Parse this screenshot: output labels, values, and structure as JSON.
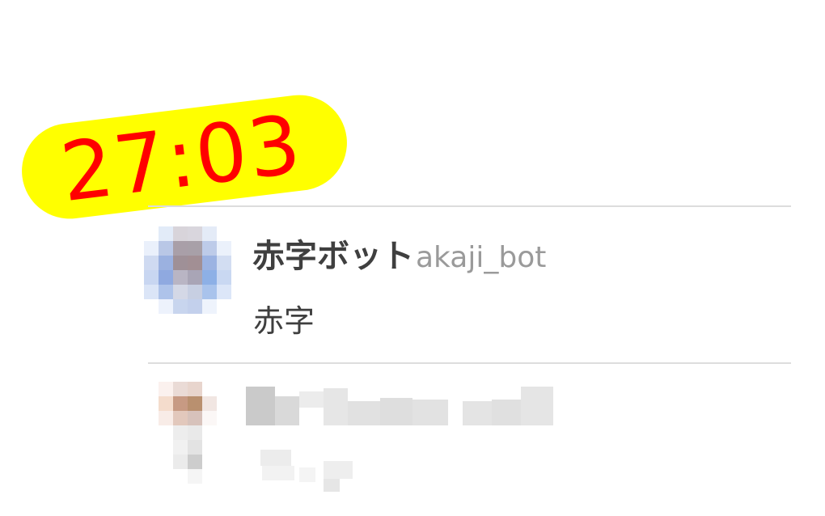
{
  "timer": {
    "text": "27:03",
    "badge_color": "#ffff00",
    "text_color": "#ff0000"
  },
  "messages": [
    {
      "display_name": "赤字ボット",
      "username": "akaji_bot",
      "body": "赤字"
    }
  ],
  "colors": {
    "divider": "#dddddd",
    "name": "#3f3f3f",
    "username": "#9a9a9a"
  }
}
